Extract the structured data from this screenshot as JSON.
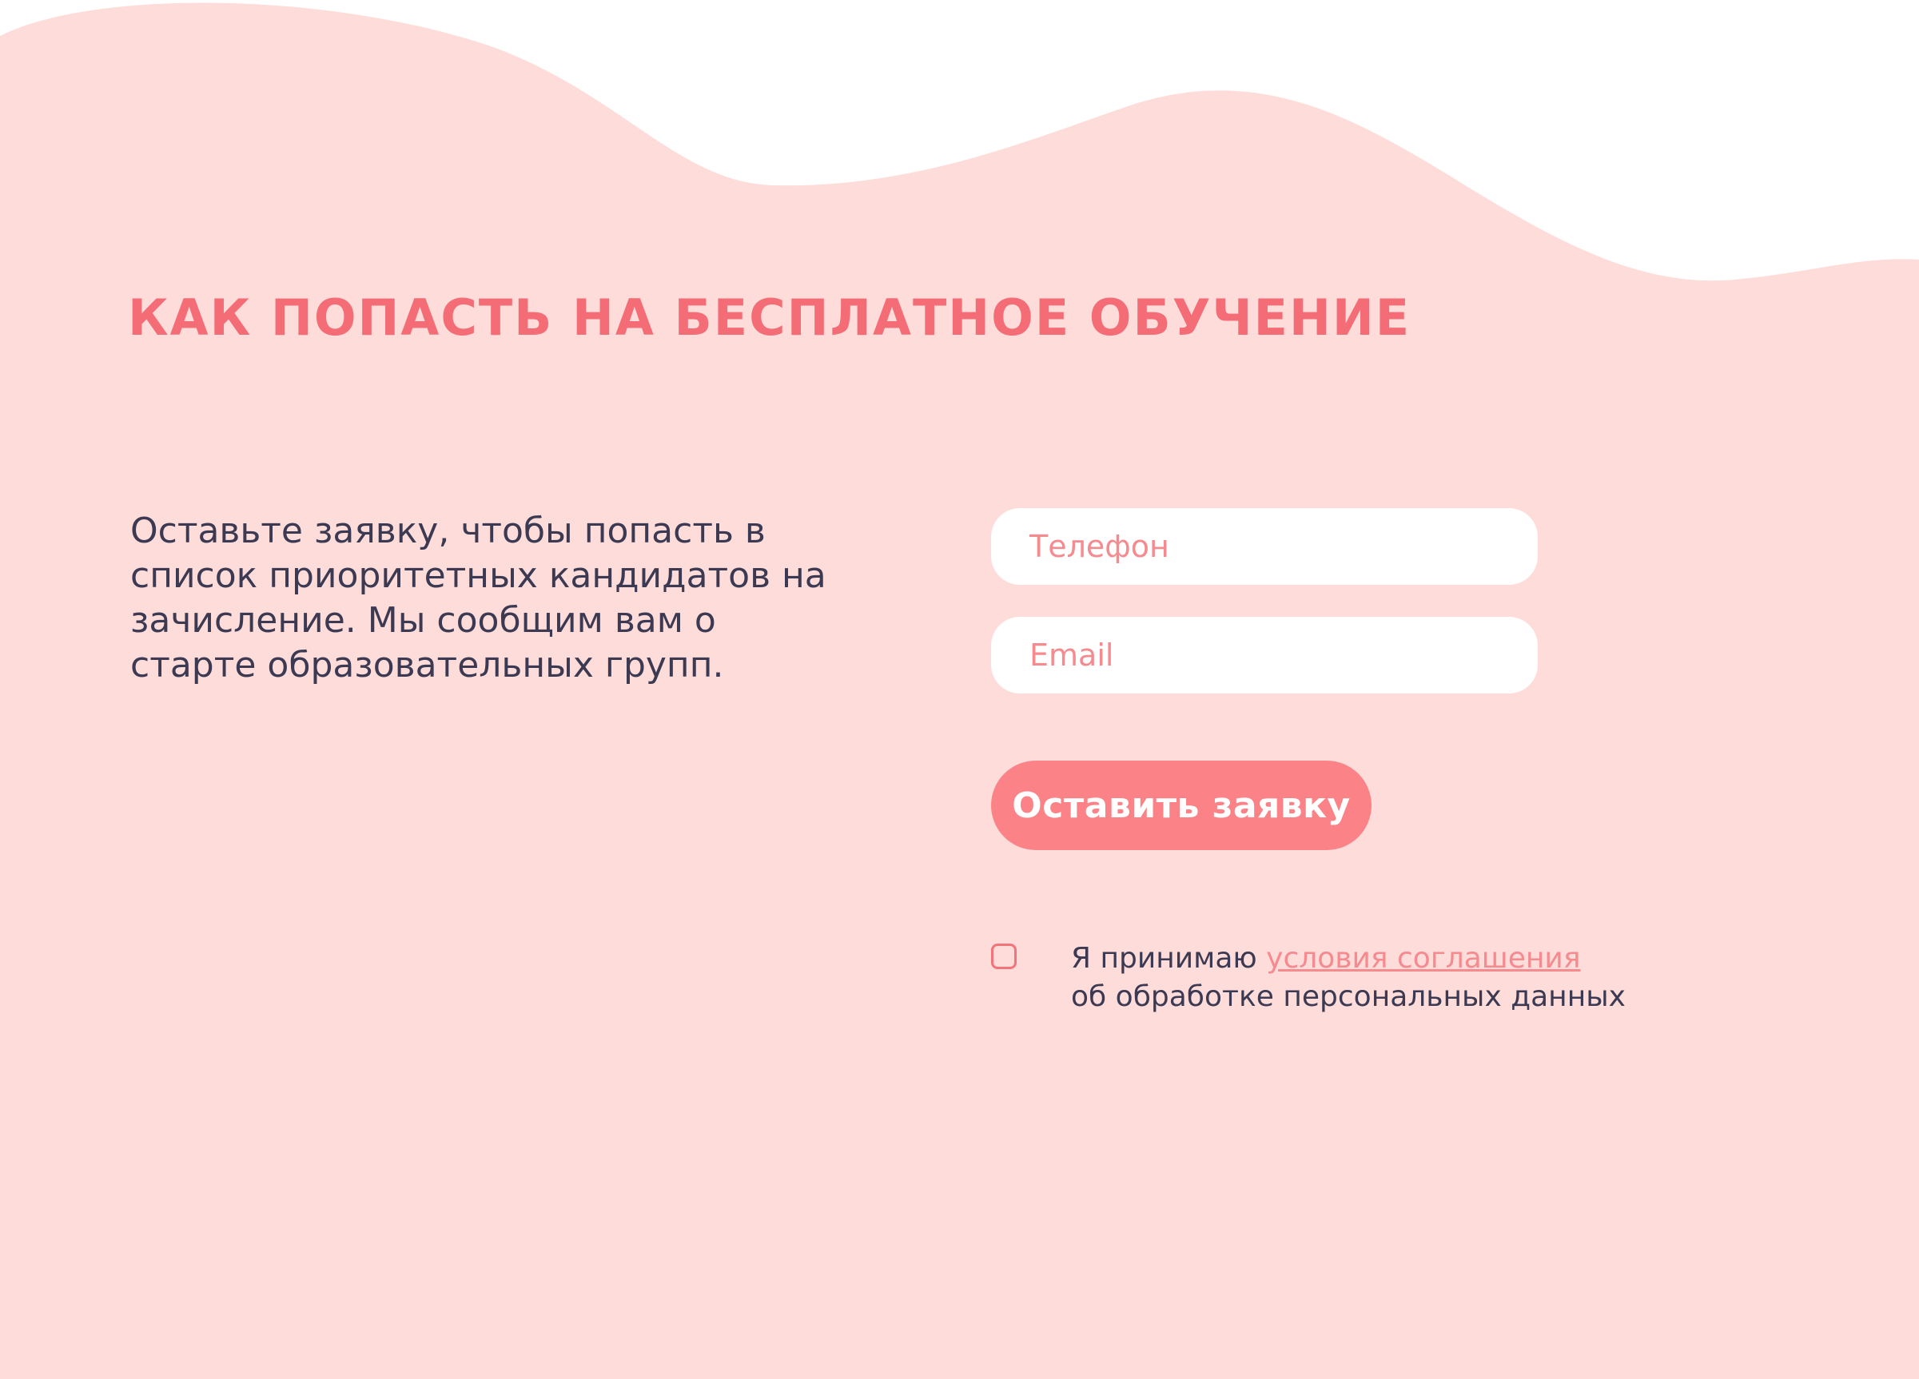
{
  "page": {
    "title": "КАК ПОПАСТЬ НА БЕСПЛАТНОЕ ОБУЧЕНИЕ",
    "description": "Оставьте заявку, чтобы попасть в список приоритетных кандидатов на зачисление. Мы сообщим вам о старте образовательных групп."
  },
  "form": {
    "phone_placeholder": "Телефон",
    "email_placeholder": "Email",
    "submit_label": "Оставить заявку",
    "consent": {
      "text_before": "Я принимаю ",
      "link_text": "условия соглашения",
      "text_after": "об обработке персональных данных",
      "checked": false
    }
  },
  "colors": {
    "background": "#fedcda",
    "accent": "#f46d76",
    "button": "#fb8387",
    "text": "#3b3a52",
    "field": "#ffffff"
  }
}
